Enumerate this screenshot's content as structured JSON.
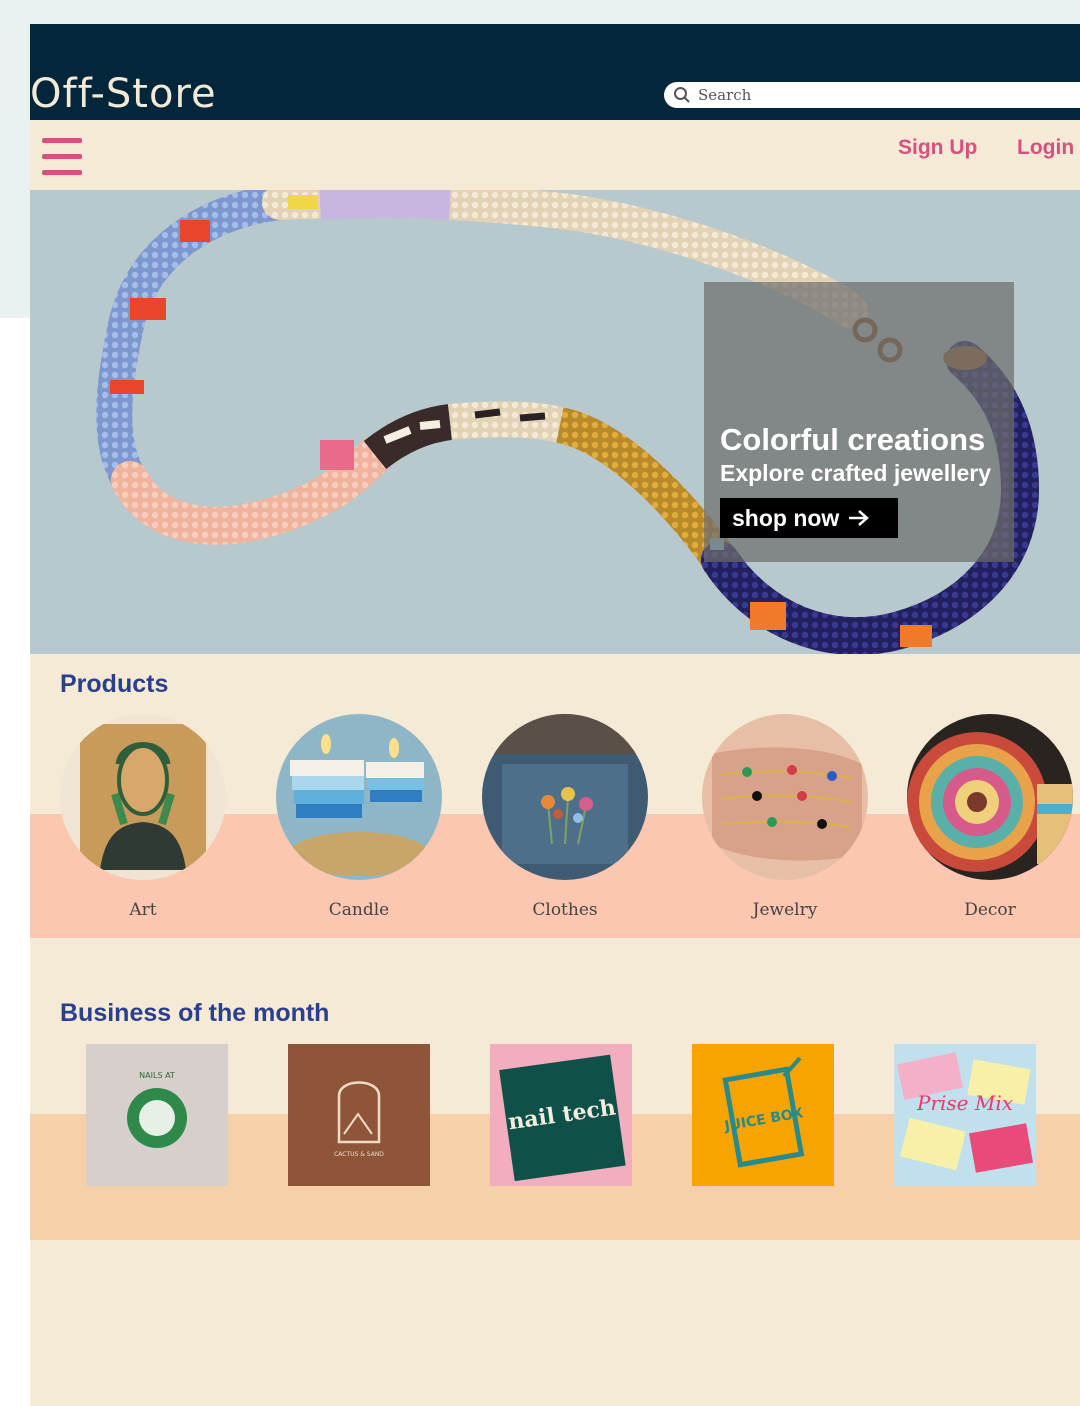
{
  "header": {
    "logo": "Off-Store",
    "search_placeholder": "Search"
  },
  "nav": {
    "menu_icon": "hamburger-menu-icon",
    "signup": "Sign Up",
    "login": "Login"
  },
  "hero": {
    "title": "Colorful creations",
    "subtitle": "Explore crafted jewellery",
    "cta": "shop now",
    "cta_icon": "arrow-right-icon"
  },
  "products": {
    "heading": "Products",
    "items": [
      {
        "label": "Art"
      },
      {
        "label": "Candle"
      },
      {
        "label": "Clothes"
      },
      {
        "label": "Jewelry"
      },
      {
        "label": "Decor"
      }
    ]
  },
  "business": {
    "heading": "Business of the month",
    "logos": [
      {
        "text": "NAILS AT"
      },
      {
        "text": "CACTUS & SAND"
      },
      {
        "text": "nail tech"
      },
      {
        "text": "JUICE BOX"
      },
      {
        "text": "Prise Mix"
      }
    ]
  },
  "colors": {
    "header_bg": "#04263a",
    "accent_pink": "#d94f80",
    "heading_blue": "#2b3f8f",
    "page_bg": "#f4ead5",
    "products_band": "#fbc7b0",
    "business_band": "#f6d0a8"
  }
}
